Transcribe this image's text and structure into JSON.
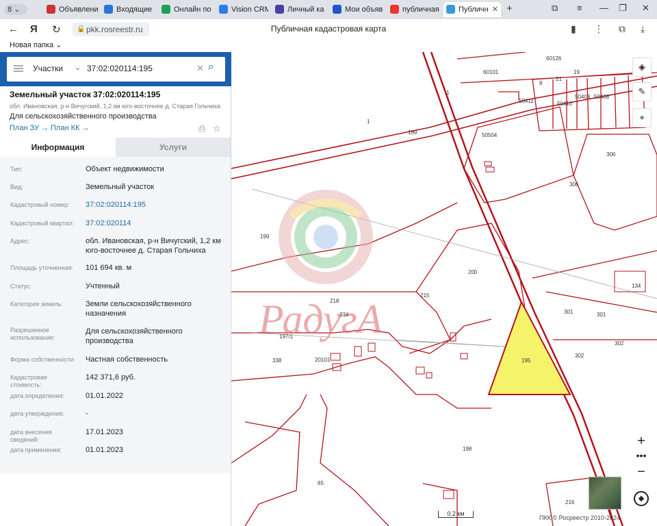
{
  "browser": {
    "tab_count": "8",
    "tabs": [
      {
        "title": "Объявлени",
        "color": "#c33"
      },
      {
        "title": "Входящие",
        "color": "#2a73d8"
      },
      {
        "title": "Онлайн по",
        "color": "#1ea05a"
      },
      {
        "title": "Vision CRM",
        "color": "#2b7de9"
      },
      {
        "title": "Личный ка",
        "color": "#4a3fa8"
      },
      {
        "title": "Мои объяв",
        "color": "#2255cc"
      },
      {
        "title": "публичная",
        "color": "#e33"
      },
      {
        "title": "Публичн",
        "color": "#3a9ad9"
      }
    ],
    "url": "pkk.rosreestr.ru",
    "page_title": "Публичная кадастровая карта",
    "bookmark_folder": "Новая папка"
  },
  "search": {
    "type": "Участки",
    "query": "37:02:020114:195"
  },
  "parcel": {
    "title": "Земельный участок 37:02:020114:195",
    "address_short": "обл. Ивановская, р-н Вичугский, 1,2 км юго-восточнее д. Старая Гольчиха",
    "purpose": "Для сельскохозяйственного производства",
    "plan_zu": "План ЗУ →",
    "plan_kk": "План КК →"
  },
  "tabs": {
    "info": "Информация",
    "services": "Услуги"
  },
  "info_rows": [
    {
      "k": "Тип:",
      "v": "Объект недвижимости"
    },
    {
      "k": "Вид:",
      "v": "Земельный участок"
    },
    {
      "k": "Кадастровый номер:",
      "v": "37:02:020114:195",
      "link": true
    },
    {
      "k": "Кадастровый квартал:",
      "v": "37:02:020114",
      "link": true
    },
    {
      "k": "Адрес:",
      "v": "обл. Ивановская, р-н Вичугский, 1,2 км юго-восточнее д. Старая Гольчиха"
    },
    {
      "k": "Площадь уточненная:",
      "v": "101 694 кв. м"
    },
    {
      "k": "Статус:",
      "v": "Учтенный"
    },
    {
      "k": "Категория земель:",
      "v": "Земли сельскохозяйственного назначения"
    },
    {
      "k": "Разрешенное использование:",
      "v": "Для сельскохозяйственного производства"
    },
    {
      "k": "Форма собственности:",
      "v": "Частная собственность"
    },
    {
      "k": "Кадастровая стоимость:",
      "v": "142 371,6 руб."
    },
    {
      "k": "дата определения:",
      "v": "01.01.2022"
    },
    {
      "k": "дата утверждения:",
      "v": "-"
    },
    {
      "k": "дата внесения сведений:",
      "v": "17.01.2023"
    },
    {
      "k": "дата применения:",
      "v": "01.01.2023"
    }
  ],
  "map": {
    "labels": [
      "60101",
      "60126",
      "8",
      "21",
      "19",
      "50408",
      "50411",
      "50410",
      "50409",
      "50412",
      "1",
      "1",
      "199",
      "50504",
      "306",
      "306",
      "199",
      "200",
      "134",
      "218",
      "215",
      "301",
      "301",
      "302",
      "302",
      "197/1",
      "334",
      "338",
      "20101",
      "195",
      "198",
      "65",
      "216"
    ],
    "watermark": "РадугА",
    "scale": "0.2 км",
    "copyright": "ПКК © Росреестр 2010-2024",
    "selected_color": "#f5f36a",
    "boundary_color": "#b3141c"
  }
}
